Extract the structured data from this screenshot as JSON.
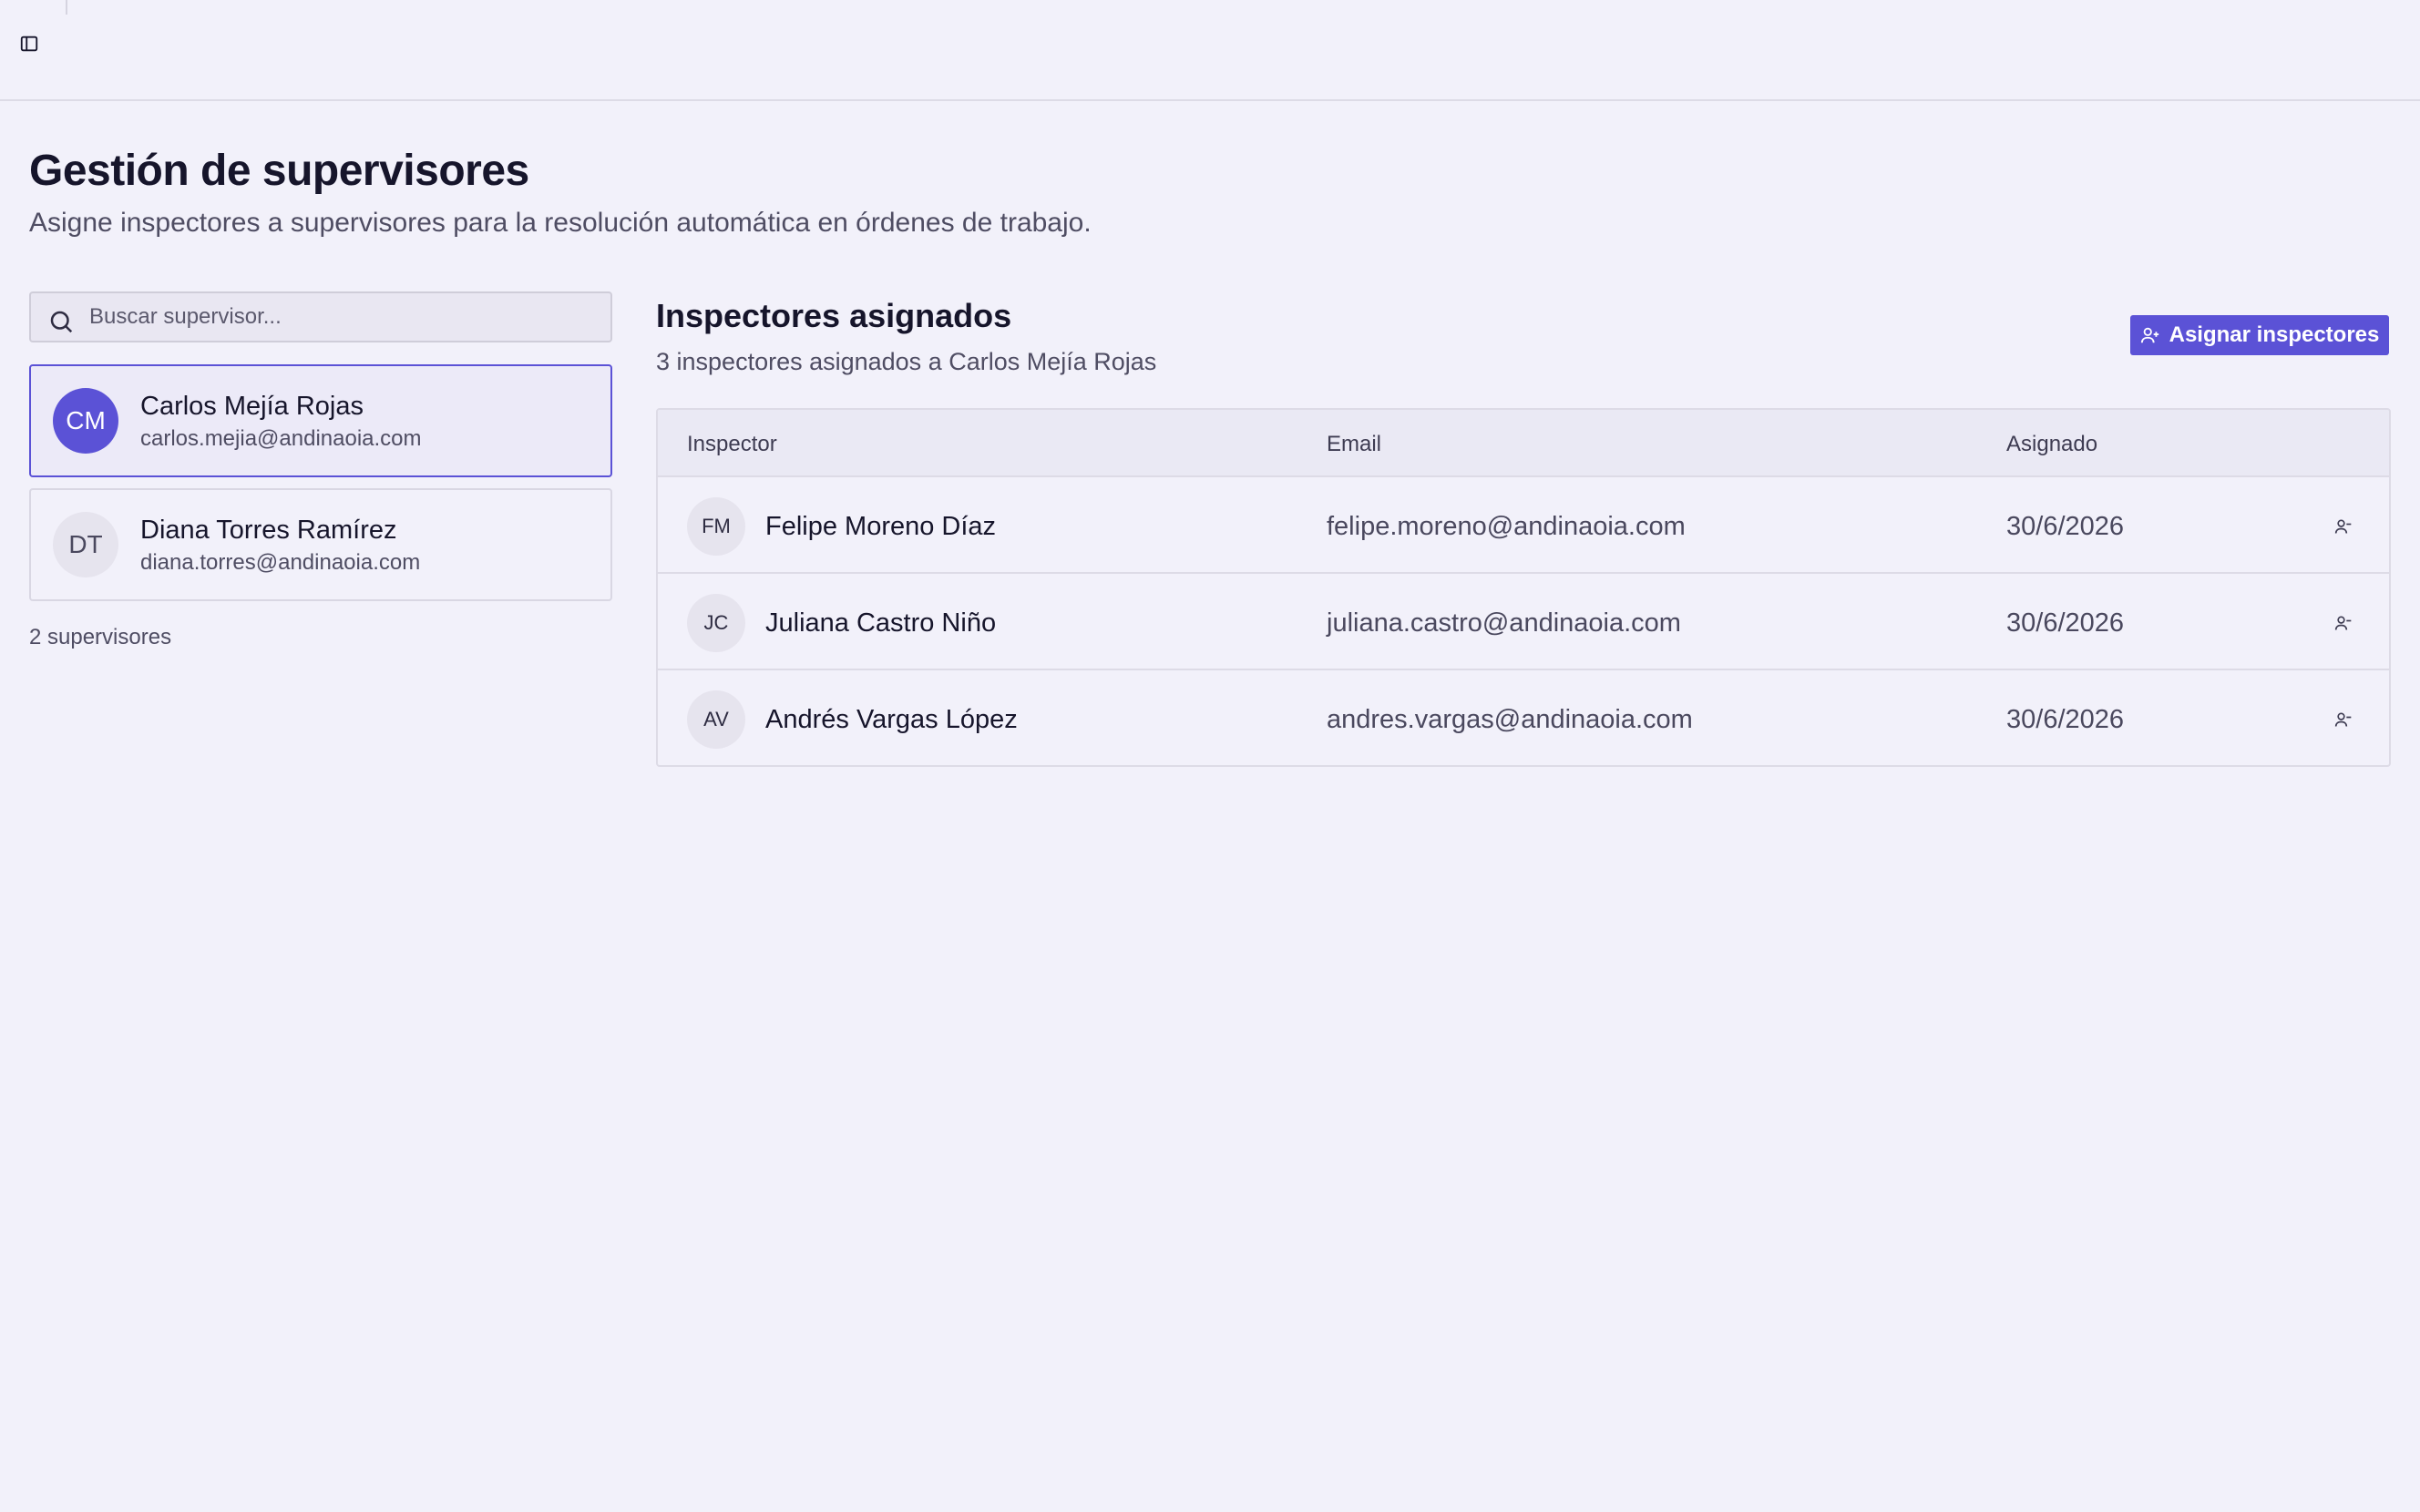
{
  "header": {
    "sidebar_toggle_icon": "panel-left-icon"
  },
  "page": {
    "title": "Gestión de supervisores",
    "subtitle": "Asigne inspectores a supervisores para la resolución automática en órdenes de trabajo."
  },
  "search": {
    "placeholder": "Buscar supervisor...",
    "value": "",
    "icon": "search-icon"
  },
  "supervisors": [
    {
      "initials": "CM",
      "name": "Carlos Mejía Rojas",
      "email": "carlos.mejia@andinaoia.com",
      "selected": true
    },
    {
      "initials": "DT",
      "name": "Diana Torres Ramírez",
      "email": "diana.torres@andinaoia.com",
      "selected": false
    }
  ],
  "supervisor_count": "2 supervisores",
  "assigned": {
    "title": "Inspectores asignados",
    "subtitle": "3 inspectores asignados a Carlos Mejía Rojas",
    "assign_button": {
      "label": "Asignar inspectores",
      "icon": "user-plus-icon"
    },
    "columns": [
      "Inspector",
      "Email",
      "Asignado"
    ],
    "rows": [
      {
        "initials": "FM",
        "name": "Felipe Moreno Díaz",
        "email": "felipe.moreno@andinaoia.com",
        "date": "30/6/2026",
        "action_icon": "user-remove-icon"
      },
      {
        "initials": "JC",
        "name": "Juliana Castro Niño",
        "email": "juliana.castro@andinaoia.com",
        "date": "30/6/2026",
        "action_icon": "user-remove-icon"
      },
      {
        "initials": "AV",
        "name": "Andrés Vargas López",
        "email": "andres.vargas@andinaoia.com",
        "date": "30/6/2026",
        "action_icon": "user-remove-icon"
      }
    ]
  },
  "colors": {
    "accent": "#5b52d6",
    "background": "#f2f1fa",
    "border": "#dddbe6"
  }
}
